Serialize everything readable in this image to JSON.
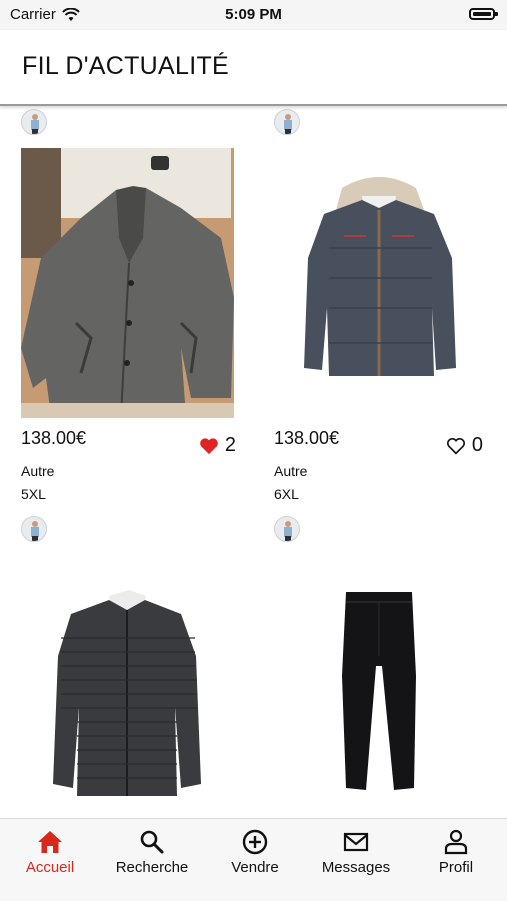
{
  "status": {
    "carrier": "Carrier",
    "time": "5:09 PM"
  },
  "header": {
    "title": "FIL D'ACTUALITÉ"
  },
  "feed": {
    "items": [
      {
        "price": "138.00€",
        "likes": "2",
        "liked": true,
        "category": "Autre",
        "size": "5XL",
        "image": "grey-wool-coat-photo"
      },
      {
        "price": "138.00€",
        "likes": "0",
        "liked": false,
        "category": "Autre",
        "size": "6XL",
        "image": "navy-hooded-puffer-jacket"
      },
      {
        "image": "black-quilted-jacket"
      },
      {
        "image": "black-trousers"
      }
    ]
  },
  "tabs": [
    {
      "label": "Accueil",
      "icon": "home-icon",
      "active": true
    },
    {
      "label": "Recherche",
      "icon": "search-icon",
      "active": false
    },
    {
      "label": "Vendre",
      "icon": "plus-circle-icon",
      "active": false
    },
    {
      "label": "Messages",
      "icon": "mail-icon",
      "active": false
    },
    {
      "label": "Profil",
      "icon": "user-icon",
      "active": false
    }
  ],
  "colors": {
    "accent": "#d6281b",
    "heart": "#e02424"
  }
}
